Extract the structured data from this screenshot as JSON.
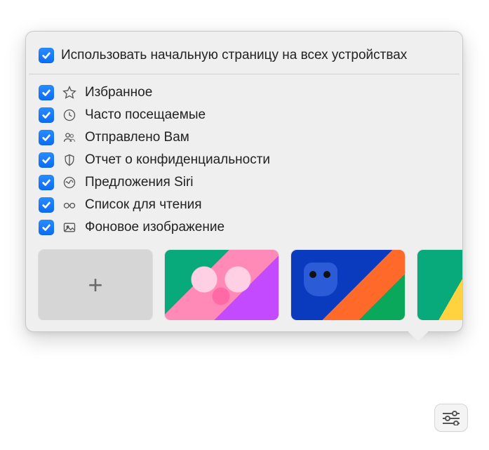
{
  "header": {
    "sync_label": "Использовать начальную страницу на всех устройствах",
    "sync_checked": true
  },
  "items": [
    {
      "icon": "star-icon",
      "label": "Избранное",
      "checked": true
    },
    {
      "icon": "clock-icon",
      "label": "Часто посещаемые",
      "checked": true
    },
    {
      "icon": "people-icon",
      "label": "Отправлено Вам",
      "checked": true
    },
    {
      "icon": "shield-icon",
      "label": "Отчет о конфиденциальности",
      "checked": true
    },
    {
      "icon": "siri-icon",
      "label": "Предложения Siri",
      "checked": true
    },
    {
      "icon": "glasses-icon",
      "label": "Список для чтения",
      "checked": true
    },
    {
      "icon": "image-icon",
      "label": "Фоновое изображение",
      "checked": true
    }
  ],
  "thumbnails": {
    "add_label": "+"
  }
}
